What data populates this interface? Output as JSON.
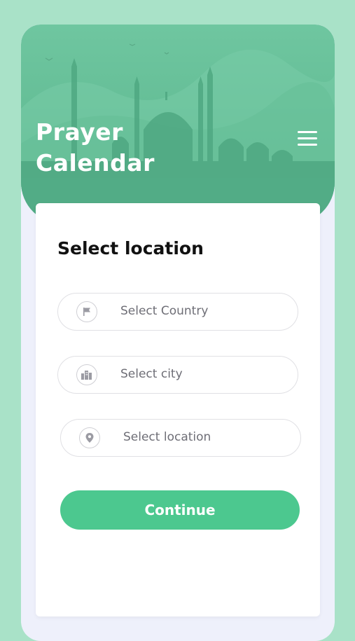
{
  "header": {
    "title_line1": "Prayer",
    "title_line2": "Calendar",
    "menu_icon": "hamburger-menu-icon",
    "background_color": "#5fb992",
    "skyline": "mosque-silhouette"
  },
  "form": {
    "heading": "Select location",
    "fields": [
      {
        "placeholder": "Select Country",
        "icon": "flag-icon"
      },
      {
        "placeholder": "Select city",
        "icon": "city-icon"
      },
      {
        "placeholder": "Select location",
        "icon": "location-pin-icon"
      }
    ],
    "continue_label": "Continue"
  },
  "colors": {
    "accent": "#4cc88f",
    "page_background": "#a9e2c8",
    "card_background": "#ffffff"
  }
}
